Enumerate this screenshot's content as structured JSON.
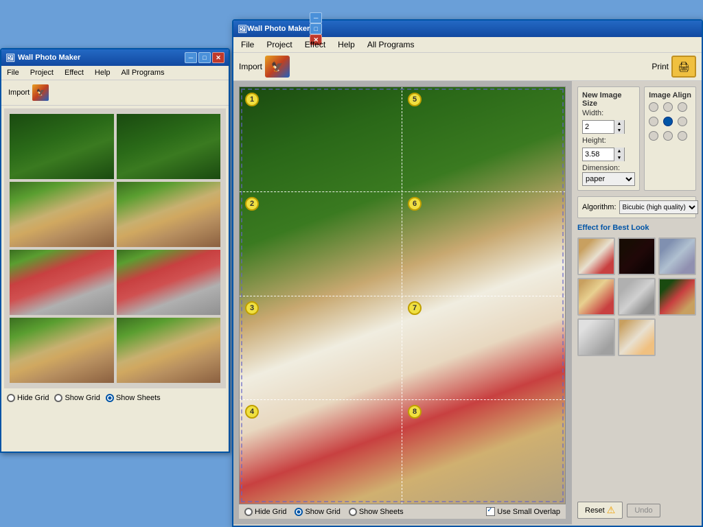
{
  "bgWindow": {
    "title": "Wall Photo Maker",
    "menuItems": [
      "File",
      "Project",
      "Effect",
      "Help",
      "All Programs"
    ],
    "toolbar": {
      "importLabel": "Import"
    },
    "previewCells": [
      {
        "id": 1,
        "type": "tree"
      },
      {
        "id": 2,
        "type": "tree"
      },
      {
        "id": 3,
        "type": "dog"
      },
      {
        "id": 4,
        "type": "dog"
      },
      {
        "id": 5,
        "type": "gifts"
      },
      {
        "id": 6,
        "type": "gifts"
      },
      {
        "id": 7,
        "type": "dog-full"
      },
      {
        "id": 8,
        "type": "dog-full"
      }
    ],
    "radioOptions": [
      {
        "id": "hide-grid-bg",
        "label": "Hide Grid",
        "checked": false
      },
      {
        "id": "show-grid-bg",
        "label": "Show Grid",
        "checked": false
      },
      {
        "id": "show-sheets-bg",
        "label": "Show Sheets",
        "checked": true
      }
    ]
  },
  "mainWindow": {
    "title": "Wall Photo Maker",
    "menuItems": [
      "File",
      "Project",
      "Effect",
      "Help",
      "All Programs"
    ],
    "toolbar": {
      "importLabel": "Import",
      "printLabel": "Print"
    },
    "gridCells": [
      {
        "number": "1"
      },
      {
        "number": "5"
      },
      {
        "number": "2"
      },
      {
        "number": "6"
      },
      {
        "number": "3"
      },
      {
        "number": "7"
      },
      {
        "number": "4"
      },
      {
        "number": "8"
      }
    ],
    "radioOptions": [
      {
        "id": "hide-grid",
        "label": "Hide Grid",
        "checked": false
      },
      {
        "id": "show-grid",
        "label": "Show Grid",
        "checked": true
      },
      {
        "id": "show-sheets",
        "label": "Show Sheets",
        "checked": false
      }
    ],
    "useSmallOverlap": {
      "label": "Use Small Overlap",
      "checked": true
    },
    "rightPanel": {
      "newImageSize": "New Image Size",
      "widthLabel": "Width:",
      "widthValue": "2",
      "heightLabel": "Height:",
      "heightValue": "3.58",
      "dimensionLabel": "Dimension:",
      "dimensionValue": "paper",
      "imageAlign": "Image Align",
      "algorithmLabel": "Algorithm:",
      "algorithmValue": "Bicubic (high quality)",
      "effectsLabel": "Effect for Best Look",
      "effects": [
        {
          "id": 1,
          "class": "eff-normal"
        },
        {
          "id": 2,
          "class": "eff-dark"
        },
        {
          "id": 3,
          "class": "eff-blue"
        },
        {
          "id": 4,
          "class": "eff-warm"
        },
        {
          "id": 5,
          "class": "eff-grey"
        },
        {
          "id": 6,
          "class": "eff-forest"
        },
        {
          "id": 7,
          "class": "eff-sketch"
        },
        {
          "id": 8,
          "class": "eff-vintage"
        }
      ],
      "resetLabel": "Reset",
      "undoLabel": "Undo"
    }
  }
}
